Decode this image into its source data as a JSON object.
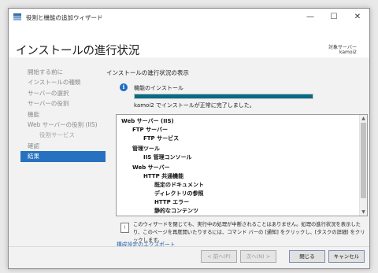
{
  "window": {
    "title": "役割と機能の追加ウィザード",
    "controls": {
      "minimize": "—",
      "maximize": "☐",
      "close": "✕"
    }
  },
  "header": {
    "page_title": "インストールの進行状況",
    "target_label": "対象サーバー",
    "target_value": "kamoi2"
  },
  "nav": {
    "items": [
      {
        "label": "開始する前に"
      },
      {
        "label": "インストールの種類"
      },
      {
        "label": "サーバーの選択"
      },
      {
        "label": "サーバーの役割"
      },
      {
        "label": "機能"
      },
      {
        "label": "Web サーバーの役割 (IIS)"
      },
      {
        "label": "役割サービス"
      },
      {
        "label": "確認"
      },
      {
        "label": "結果"
      }
    ]
  },
  "content": {
    "section_label": "インストールの進行状況の表示",
    "feature_label": "機能のインストール",
    "progress": 1.0,
    "status_text": "kamoi2 でインストールが正常に完了しました。",
    "tree": [
      {
        "label": "Web サーバー (IIS)"
      },
      {
        "label": "FTP サーバー"
      },
      {
        "label": "FTP サービス"
      },
      {
        "label": "管理ツール"
      },
      {
        "label": "IIS 管理コンソール"
      },
      {
        "label": "Web サーバー"
      },
      {
        "label": "HTTP 共通機能"
      },
      {
        "label": "既定のドキュメント"
      },
      {
        "label": "ディレクトリの参照"
      },
      {
        "label": "HTTP エラー"
      },
      {
        "label": "静的なコンテンツ"
      }
    ],
    "note_line1": "このウィザードを閉じても、実行中の処理が中断されることはありません。処理の進行状況を表示したり、このページを再度開いたりするには、コマンド バーの [通知] をクリックし、[タスクの詳細] をクリックします。",
    "export_link": "構成設定のエクスポート"
  },
  "footer": {
    "back": "< 前へ(P)",
    "next": "次へ(N) >",
    "close": "閉じる",
    "cancel": "キャンセル"
  },
  "colors": {
    "nav_active": "#2672c0",
    "progress_fill": "#0b6a83",
    "link": "#1f5fa8",
    "info_icon": "#1f6cc6"
  }
}
